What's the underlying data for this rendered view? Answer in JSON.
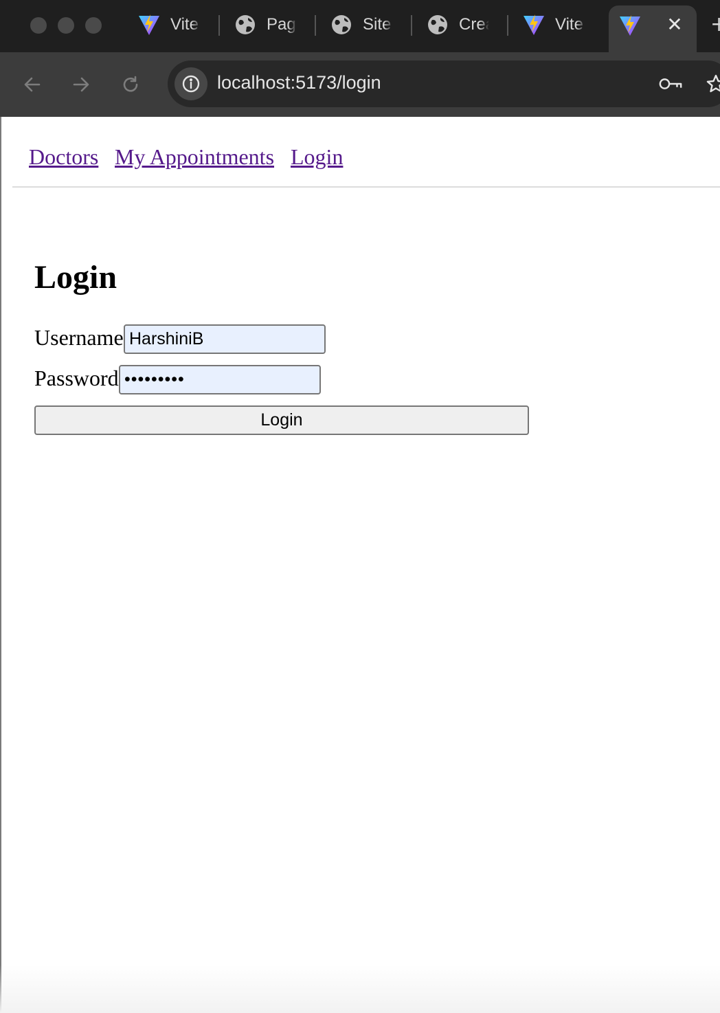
{
  "browser": {
    "tabs": [
      {
        "label": "Vite",
        "icon": "vite-icon"
      },
      {
        "label": "Page",
        "icon": "globe-icon"
      },
      {
        "label": "Site",
        "icon": "globe-icon"
      },
      {
        "label": "Crea",
        "icon": "globe-icon"
      },
      {
        "label": "Vite",
        "icon": "vite-icon"
      }
    ],
    "active_tab": {
      "icon": "vite-icon",
      "close_glyph": "✕"
    },
    "new_tab_glyph": "+",
    "url": "localhost:5173/login",
    "colors": {
      "chrome_dark": "#1f1f1f",
      "toolbar": "#3c3c3c",
      "omnibox": "#282828"
    }
  },
  "nav": {
    "links": [
      "Doctors",
      "My Appointments",
      "Login"
    ],
    "link_color": "#551a8b"
  },
  "login_form": {
    "title": "Login",
    "username_label": "Username",
    "username_value": "HarshiniB",
    "password_label": "Password",
    "password_value": "•••••••••",
    "submit_label": "Login",
    "autofill_bg": "#e8f0fe"
  }
}
